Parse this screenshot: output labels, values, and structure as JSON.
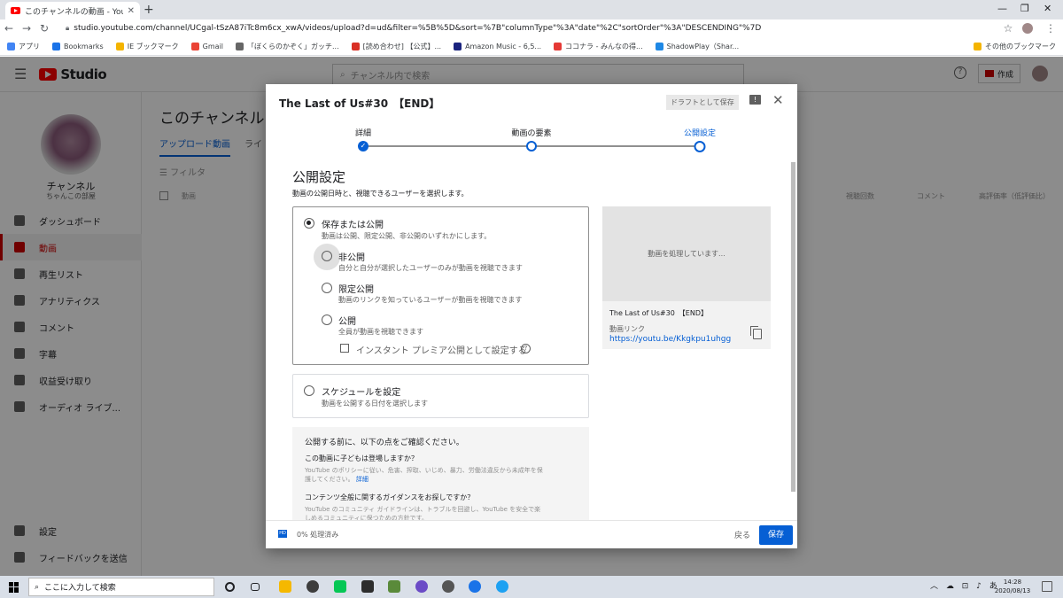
{
  "browser": {
    "tab_title": "このチャンネルの動画 - YouTube Studio",
    "url": "studio.youtube.com/channel/UCgal-tSzA87iTc8m6cx_xwA/videos/upload?d=ud&filter=%5B%5D&sort=%7B\"columnType\"%3A\"date\"%2C\"sortOrder\"%3A\"DESCENDING\"%7D",
    "bookmarks": [
      "アプリ",
      "Bookmarks",
      "IE ブックマーク",
      "Gmail",
      "「ぼくらのかぞく」ガッチ...",
      "[読め合わせ] 【公式】...",
      "Amazon Music - 6,5...",
      "ココナラ - みんなの得...",
      "ShadowPlay（Shar..."
    ],
    "bookmark_other": "その他のブックマーク",
    "bookmark_colors": [
      "#4285f4",
      "#1a73e8",
      "#f4b400",
      "#ea4335",
      "#666666",
      "#d93025",
      "#1a237e",
      "#e53935",
      "#1e88e5"
    ]
  },
  "studio": {
    "logo": "Studio",
    "search_placeholder": "チャンネル内で検索",
    "create_label": "作成",
    "help_icon": "?",
    "channel_name": "チャンネル",
    "channel_sub": "ちゃんこの部屋",
    "nav": [
      "ダッシュボード",
      "動画",
      "再生リスト",
      "アナリティクス",
      "コメント",
      "字幕",
      "収益受け取り",
      "オーディオ ライブ..."
    ],
    "nav_bottom": [
      "設定",
      "フィードバックを送信"
    ],
    "page_title": "このチャンネルの動画",
    "tabs": [
      "アップロード動画",
      "ライ"
    ],
    "filter_label": "フィルタ",
    "columns": [
      "動画",
      "視聴回数",
      "コメント",
      "高評価率（低評価比）"
    ]
  },
  "dialog": {
    "title": "The Last of Us#30　【END】",
    "draft_label": "ドラフトとして保存",
    "steps": [
      "詳細",
      "動画の要素",
      "公開設定"
    ],
    "visibility_title": "公開設定",
    "visibility_desc": "動画の公開日時と、視聴できるユーザーを選択します。",
    "save_publish": {
      "label": "保存または公開",
      "sub": "動画は公開、限定公開、非公開のいずれかにします。"
    },
    "private": {
      "label": "非公開",
      "sub": "自分と自分が選択したユーザーのみが動画を視聴できます"
    },
    "unlisted": {
      "label": "限定公開",
      "sub": "動画のリンクを知っているユーザーが動画を視聴できます"
    },
    "public": {
      "label": "公開",
      "sub": "全員が動画を視聴できます"
    },
    "premiere_label": "インスタント プレミア公開として設定する",
    "schedule": {
      "label": "スケジュールを設定",
      "sub": "動画を公開する日付を選択します"
    },
    "checklist": {
      "title": "公開する前に、以下の点をご確認ください。",
      "q1": "この動画に子どもは登場しますか？",
      "q1_text": "YouTube のポリシーに従い、危害、搾取、いじめ、暴力、労働法違反から未成年を保護してください。",
      "q1_link": "詳細",
      "q2": "コンテンツ全般に関するガイダンスをお探しですか？",
      "q2_text": "YouTube のコミュニティ ガイドラインは、トラブルを回避し、YouTube を安全で楽しめるコミュニティに保つための方針です。"
    },
    "preview": {
      "processing": "動画を処理しています...",
      "title": "The Last of Us#30　【END】",
      "link_label": "動画リンク",
      "link": "https://youtu.be/Kkgkpu1uhgg"
    },
    "processing_status": "0% 処理済み",
    "back_label": "戻る",
    "save_label": "保存"
  },
  "taskbar": {
    "search_placeholder": "ここに入力して検索",
    "time": "14:28",
    "date": "2020/08/13",
    "app_colors": [
      "#f5b800",
      "#3d3d3d",
      "#06c755",
      "#2d2d2d",
      "#5a8a3a",
      "#6b4bc6",
      "#555555",
      "#1a73e8",
      "#1da1f2"
    ]
  }
}
